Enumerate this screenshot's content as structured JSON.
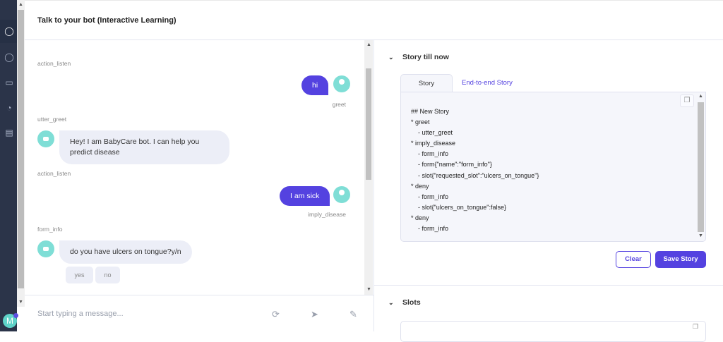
{
  "header": {
    "title": "Talk to your bot (Interactive Learning)"
  },
  "sidebar": {
    "icons": [
      "chat-icon",
      "conversations-icon",
      "inbox-icon",
      "dashboard-icon",
      "document-check-icon"
    ],
    "avatar_letter": "M"
  },
  "chat": {
    "action1": "action_listen",
    "user1": {
      "text": "hi",
      "intent": "greet"
    },
    "action2": "utter_greet",
    "bot1": "Hey! I am BabyCare bot. I can help you predict disease",
    "action3": "action_listen",
    "user2": {
      "text": "I am sick",
      "intent": "imply_disease"
    },
    "action4": "form_info",
    "bot2": "do you have ulcers on tongue?y/n",
    "quick_replies": [
      "yes",
      "no"
    ]
  },
  "input": {
    "placeholder": "Start typing a message..."
  },
  "story": {
    "heading": "Story till now",
    "tabs": [
      "Story",
      "End-to-end Story"
    ],
    "lines": [
      "## New Story",
      "* greet",
      "    - utter_greet",
      "* imply_disease",
      "    - form_info",
      "    - form{\"name\":\"form_info\"}",
      "    - slot{\"requested_slot\":\"ulcers_on_tongue\"}",
      "* deny",
      "    - form_info",
      "    - slot{\"ulcers_on_tongue\":false}",
      "* deny",
      "    - form_info"
    ],
    "clear_label": "Clear",
    "save_label": "Save Story"
  },
  "slots": {
    "heading": "Slots"
  },
  "colors": {
    "accent": "#5442e0",
    "sidebar": "#2b3449",
    "avatar": "#7fded6"
  }
}
